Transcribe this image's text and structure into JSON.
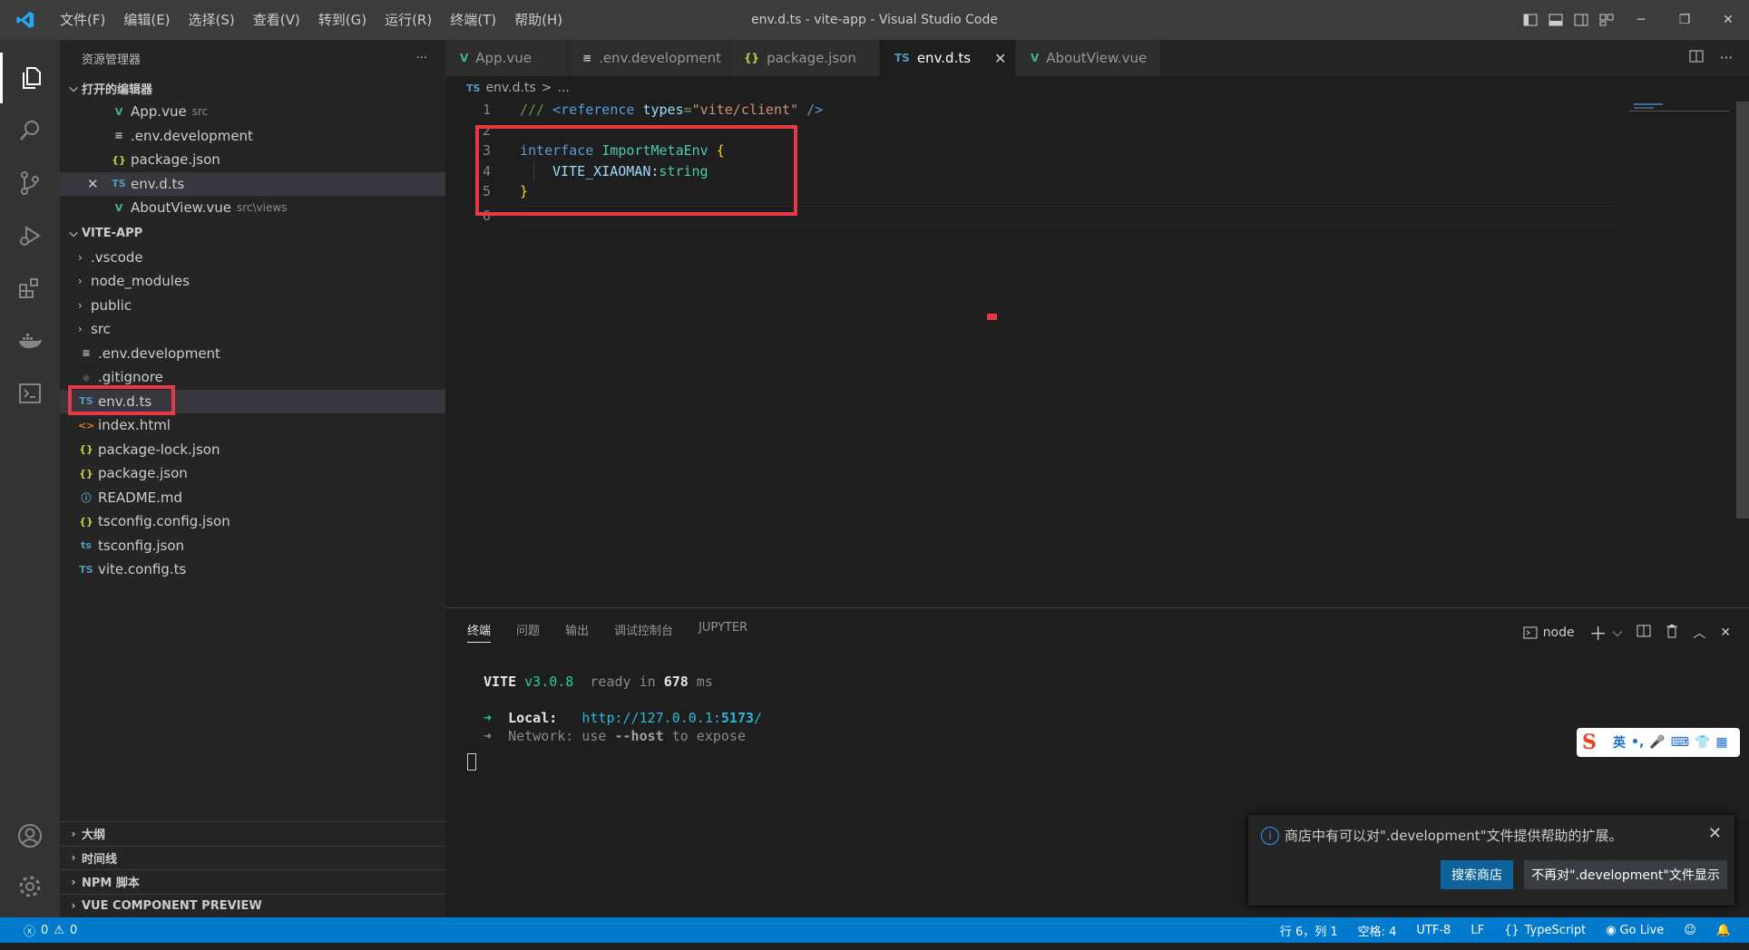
{
  "window": {
    "title": "env.d.ts - vite-app - Visual Studio Code",
    "menu": [
      "文件(F)",
      "编辑(E)",
      "选择(S)",
      "查看(V)",
      "转到(G)",
      "运行(R)",
      "终端(T)",
      "帮助(H)"
    ]
  },
  "sidebar": {
    "header": "资源管理器",
    "more": "···",
    "open_editors_title": "打开的编辑器",
    "open_editors": [
      {
        "icon": "V",
        "icon_color": "#41b883",
        "name": "App.vue",
        "desc": "src"
      },
      {
        "icon": "≡",
        "icon_color": "#cccccc",
        "name": ".env.development",
        "desc": ""
      },
      {
        "icon": "{}",
        "icon_color": "#cbcb41",
        "name": "package.json",
        "desc": ""
      },
      {
        "icon": "TS",
        "icon_color": "#519aba",
        "name": "env.d.ts",
        "desc": ""
      },
      {
        "icon": "V",
        "icon_color": "#41b883",
        "name": "AboutView.vue",
        "desc": "src\\views"
      }
    ],
    "project_title": "VITE-APP",
    "folders": [
      ".vscode",
      "node_modules",
      "public",
      "src"
    ],
    "files": [
      {
        "icon": "≡",
        "icon_color": "#cccccc",
        "name": ".env.development"
      },
      {
        "icon": "◆",
        "icon_color": "#41535b",
        "name": ".gitignore"
      },
      {
        "icon": "TS",
        "icon_color": "#519aba",
        "name": "env.d.ts"
      },
      {
        "icon": "<>",
        "icon_color": "#e37933",
        "name": "index.html"
      },
      {
        "icon": "{}",
        "icon_color": "#cbcb41",
        "name": "package-lock.json"
      },
      {
        "icon": "{}",
        "icon_color": "#cbcb41",
        "name": "package.json"
      },
      {
        "icon": "ⓘ",
        "icon_color": "#519aba",
        "name": "README.md"
      },
      {
        "icon": "{}",
        "icon_color": "#cbcb41",
        "name": "tsconfig.config.json"
      },
      {
        "icon": "ts",
        "icon_color": "#519aba",
        "name": "tsconfig.json"
      },
      {
        "icon": "TS",
        "icon_color": "#519aba",
        "name": "vite.config.ts"
      }
    ],
    "bottom_sections": [
      "大纲",
      "时间线",
      "NPM 脚本",
      "VUE COMPONENT PREVIEW"
    ]
  },
  "tabs": [
    {
      "icon": "V",
      "icon_color": "#41b883",
      "label": "App.vue"
    },
    {
      "icon": "≡",
      "icon_color": "#cccccc",
      "label": ".env.development"
    },
    {
      "icon": "{}",
      "icon_color": "#cbcb41",
      "label": "package.json"
    },
    {
      "icon": "TS",
      "icon_color": "#519aba",
      "label": "env.d.ts",
      "active": true
    },
    {
      "icon": "V",
      "icon_color": "#41b883",
      "label": "AboutView.vue"
    }
  ],
  "breadcrumb": {
    "icon": "TS",
    "file": "env.d.ts",
    "sep": ">",
    "rest": "..."
  },
  "editor": {
    "line_numbers": [
      "1",
      "2",
      "3",
      "4",
      "5",
      "6"
    ],
    "code": {
      "l1_comment": "/// ",
      "l1_tag_open": "<reference ",
      "l1_attr": "types",
      "l1_eq": "=",
      "l1_str": "\"vite/client\"",
      "l1_tag_close": " />",
      "l3_kw": "interface ",
      "l3_type": "ImportMetaEnv ",
      "l3_brace": "{",
      "l4_prop": "VITE_XIAOMAN",
      "l4_colon": ":",
      "l4_type": "string",
      "l5_brace": "}"
    }
  },
  "panel": {
    "tabs": [
      "终端",
      "问题",
      "输出",
      "调试控制台",
      "JUPYTER"
    ],
    "terminal_name": "node",
    "terminal": {
      "vite": "VITE",
      "version": " v3.0.8",
      "ready": "  ready in ",
      "ms_value": "678",
      "ms": " ms",
      "arrow": "➜",
      "local_label": "  Local:",
      "local_url_base": "   http://127.0.0.1:",
      "local_port": "5173",
      "local_slash": "/",
      "network_label": "  Network:",
      "network_rest": " use ",
      "network_flag": "--host",
      "network_tail": " to expose"
    }
  },
  "ime": {
    "lang": "英",
    "punct": "•,",
    "mic": "🎤",
    "kbd": "⌨",
    "shirt": "👕",
    "grid": "▦"
  },
  "notification": {
    "message": "商店中有可以对\".development\"文件提供帮助的扩展。",
    "primary": "搜索商店",
    "secondary": "不再对\".development\"文件显示"
  },
  "status": {
    "errors": "0",
    "warnings": "0",
    "position": "行 6，列 1",
    "spaces": "空格: 4",
    "encoding": "UTF-8",
    "eol": "LF",
    "language": "TypeScript",
    "golive": "Go Live"
  },
  "colors": {
    "accent": "#007acc",
    "highlight": "#e53945"
  }
}
